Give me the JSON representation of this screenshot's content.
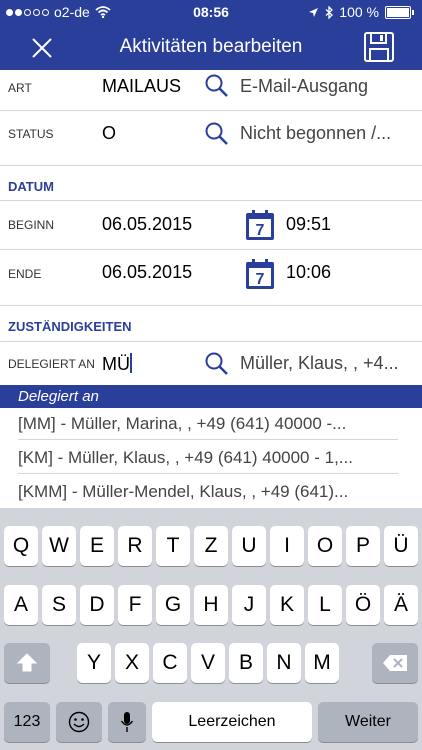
{
  "status_bar": {
    "carrier": "o2-de",
    "time": "08:56",
    "battery": "100 %"
  },
  "nav": {
    "title": "Aktivitäten bearbeiten"
  },
  "fields": {
    "art": {
      "label": "ART",
      "value": "MAILAUS",
      "lookup": "E-Mail-Ausgang"
    },
    "status": {
      "label": "STATUS",
      "value": "O",
      "lookup": "Nicht begonnen /..."
    }
  },
  "sections": {
    "datum": "DATUM",
    "zustaendigkeiten": "ZUSTÄNDIGKEITEN"
  },
  "datum": {
    "beginn": {
      "label": "BEGINN",
      "date": "06.05.2015",
      "time": "09:51",
      "cal_day": "7"
    },
    "ende": {
      "label": "ENDE",
      "date": "06.05.2015",
      "time": "10:06",
      "cal_day": "7"
    }
  },
  "delegiert": {
    "label": "DELEGIERT AN",
    "value": "MÜ",
    "lookup": "Müller, Klaus, , +4..."
  },
  "suggestions": {
    "header": "Delegiert an",
    "items": [
      "[MM] - Müller, Marina, , +49 (641) 40000 -...",
      "[KM] - Müller, Klaus, , +49 (641) 40000 - 1,...",
      "[KMM] - Müller-Mendel, Klaus, , +49 (641)..."
    ]
  },
  "keyboard": {
    "row1": [
      "Q",
      "W",
      "E",
      "R",
      "T",
      "Z",
      "U",
      "I",
      "O",
      "P",
      "Ü"
    ],
    "row2": [
      "A",
      "S",
      "D",
      "F",
      "G",
      "H",
      "J",
      "K",
      "L",
      "Ö",
      "Ä"
    ],
    "row3": [
      "Y",
      "X",
      "C",
      "V",
      "B",
      "N",
      "M"
    ],
    "numbers": "123",
    "space": "Leerzeichen",
    "return": "Weiter"
  },
  "colors": {
    "brand": "#2a3f9a",
    "keyboard_bg": "#d1d5db"
  }
}
